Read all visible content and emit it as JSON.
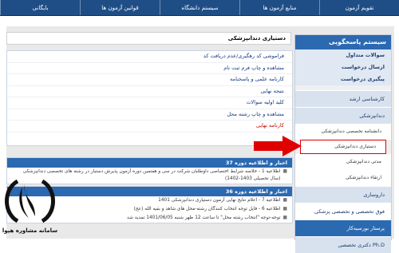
{
  "topnav": {
    "items": [
      "تقویم آزمون",
      "منابع آزمون ها",
      "سیستم دانشگاه",
      "قوانین آزمون ها",
      "بایگانی"
    ]
  },
  "sidebar": {
    "header": "سیستم پاسخگویی",
    "links": [
      "سوالات متداول",
      "ارسال درخواست",
      "پیگیری درخواست"
    ],
    "categories": [
      {
        "label": "کارشناسی ارشد"
      },
      {
        "label": "دندانپزشکی"
      }
    ],
    "sub_items": [
      "دانشنامه تخصصی دندانپزشکی",
      "دستیاری دندانپزشکی",
      "مدتی دندانپزشکی",
      "ارتقاء دندانپزشکی"
    ],
    "more_categories": [
      "داروسازی",
      "فوق تخصصی و تخصصی پزشکی",
      "پرستار بورسیه‌کار",
      "دکتری تخصصی Ph.D"
    ]
  },
  "main": {
    "title": "دستیاری دندانپزشکی",
    "links": [
      "فراموشی کد رهگیری/عدم دریافت کد",
      "مشاهده و چاپ فرم ثبت نام",
      "کارنامه علمی و پاسخنامه",
      "نتیجه نهایی",
      "کلید اولیه سوالات",
      "مشاهده و چاپ رشته محل",
      "کارنامه نهایی"
    ]
  },
  "news": [
    {
      "header": "اخبار و اطلاعیه دوره 37",
      "items": [
        "اطلاعیه 1 - خلاصه شرایط اختصاصی داوطلبان شرکت در سی و هفتمین دوره آزمون پذیرش دستیار در رشته های تخصصی دندانپزشکی (سال تحصیلی 1403-1402)"
      ]
    },
    {
      "header": "اخبار و اطلاعیه دوره 36",
      "items": [
        "اطلاعیه 7 - اعلام نتایج نهایی آزمون دستیاری دندانپزشکی 1401",
        "اطلاعیه 6 - فایل توجه انتخاب کنندگان رشته-محل های شاهد و بقیه الله (عج)",
        "توجه-توجه \"انتخاب رشته محل\" تا ساعت 12 ظهر شنبه 1401/06/05 تمدید شد"
      ]
    }
  ],
  "logo": {
    "text": "سامانه مشاوره هپوا"
  },
  "colors": {
    "primary": "#2b69b1",
    "nav": "#1f4e86",
    "highlight": "#e00000"
  }
}
